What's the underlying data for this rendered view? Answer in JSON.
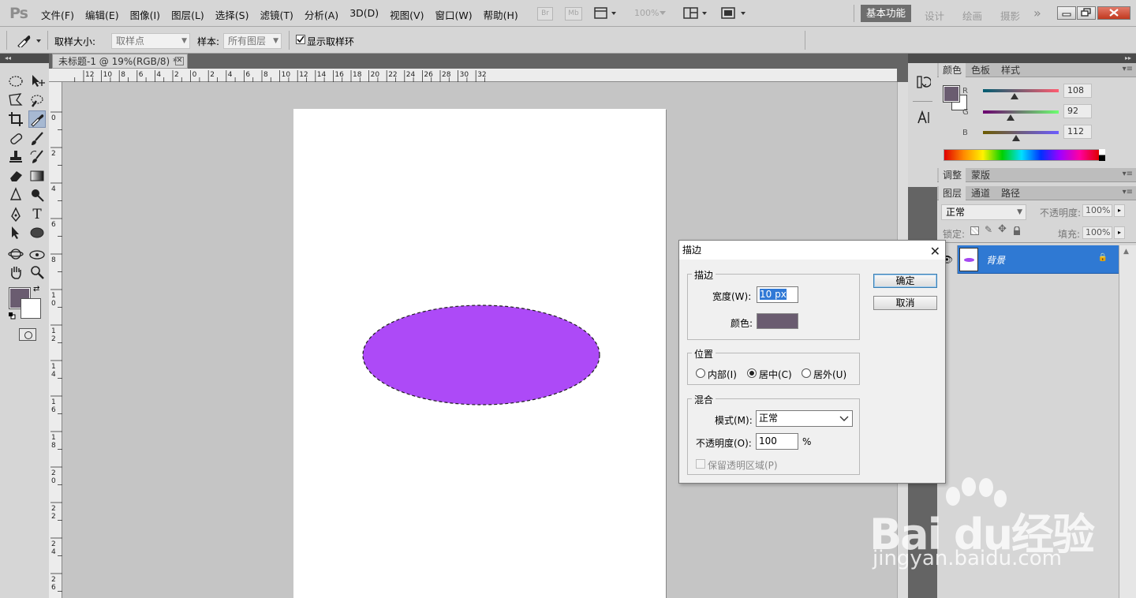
{
  "app": {
    "logo": "Ps"
  },
  "menu": [
    "文件(F)",
    "编辑(E)",
    "图像(I)",
    "图层(L)",
    "选择(S)",
    "滤镜(T)",
    "分析(A)",
    "3D(D)",
    "视图(V)",
    "窗口(W)",
    "帮助(H)"
  ],
  "appbar": {
    "br": "Br",
    "mb": "Mb",
    "zoom": "100%"
  },
  "workspaces": {
    "active": "基本功能",
    "others": [
      "设计",
      "绘画",
      "摄影"
    ],
    "more": "»"
  },
  "options": {
    "size_label": "取样大小:",
    "size_value": "取样点",
    "sample_label": "样本:",
    "sample_value": "所有图层",
    "ring_label": "显示取样环"
  },
  "document": {
    "tab_title": "未标题-1 @ 19%(RGB/8) *"
  },
  "ruler": {
    "h_labels": [
      "12",
      "10",
      "8",
      "6",
      "4",
      "2",
      "0",
      "2",
      "4",
      "6",
      "8",
      "10",
      "12",
      "14",
      "16",
      "18",
      "20",
      "22",
      "24",
      "26",
      "28",
      "30",
      "32"
    ],
    "v_labels": [
      "0",
      "2",
      "4",
      "6",
      "8",
      "1 0",
      "1 2",
      "1 4",
      "1 6",
      "1 8",
      "2 0",
      "2 2",
      "2 4",
      "2 6"
    ]
  },
  "colors": {
    "foreground": "#6a5c70",
    "ellipse_fill": "#ad4af7",
    "selection": "#1d1d1d",
    "highlight": "#2f79d3"
  },
  "color_panel": {
    "tabs": [
      "颜色",
      "色板",
      "样式"
    ],
    "channels": [
      {
        "label": "R",
        "value": "108",
        "fraction": 0.42
      },
      {
        "label": "G",
        "value": "92",
        "fraction": 0.36
      },
      {
        "label": "B",
        "value": "112",
        "fraction": 0.44
      }
    ]
  },
  "adjust_panel": {
    "tabs": [
      "调整",
      "蒙版"
    ]
  },
  "layers_panel": {
    "tabs": [
      "图层",
      "通道",
      "路径"
    ],
    "blend_mode": "正常",
    "opacity_label": "不透明度:",
    "opacity_value": "100%",
    "lock_label": "锁定:",
    "fill_label": "填充:",
    "fill_value": "100%",
    "layer_name": "背景"
  },
  "dialog": {
    "title": "描边",
    "stroke_group": "描边",
    "width_label": "宽度(W):",
    "width_value": "10 px",
    "color_label": "颜色:",
    "position_group": "位置",
    "pos_inside": "内部(I)",
    "pos_center": "居中(C)",
    "pos_outside": "居外(U)",
    "blend_group": "混合",
    "mode_label": "模式(M):",
    "mode_value": "正常",
    "opacity_label": "不透明度(O):",
    "opacity_value": "100",
    "opacity_unit": "%",
    "preserve_label": "保留透明区域(P)",
    "ok": "确定",
    "cancel": "取消"
  },
  "watermark": {
    "brand": "Bai du经验",
    "url": "jingyan.baidu.com"
  }
}
